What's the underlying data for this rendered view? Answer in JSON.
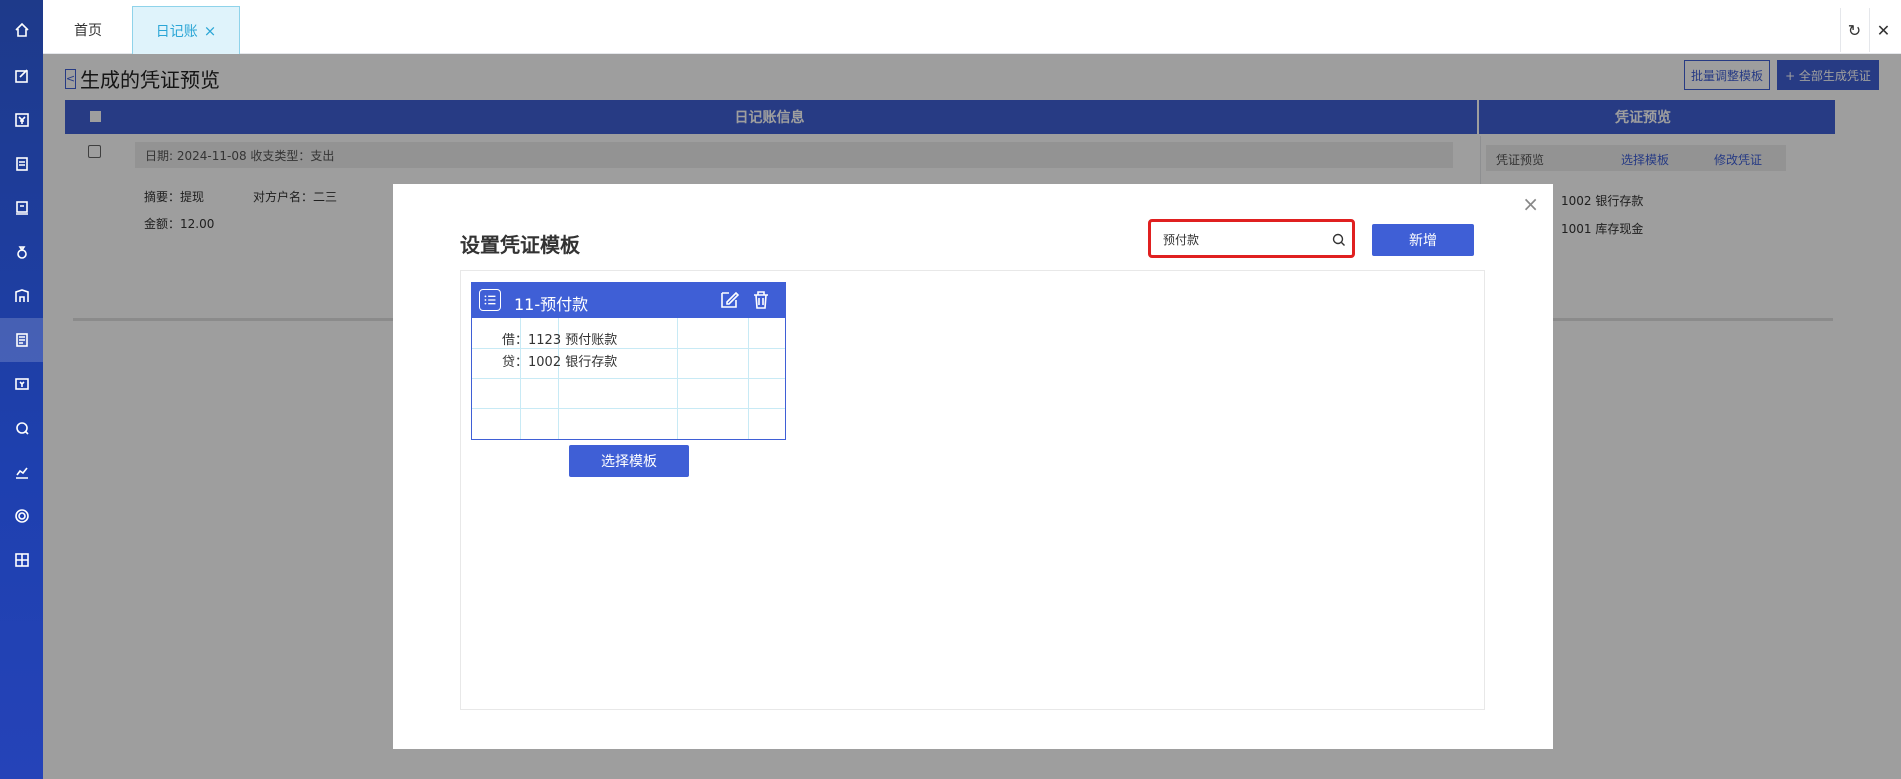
{
  "tabs": {
    "home": "首页",
    "active": "日记账",
    "close": "×"
  },
  "top_actions": {
    "refresh": "↻",
    "close": "✕"
  },
  "page": {
    "title": "生成的凭证预览",
    "back": "<",
    "batch_button": "批量调整模板",
    "generate_all_button": "+ 全部生成凭证",
    "header_left": "日记账信息",
    "header_right": "凭证预览"
  },
  "entry": {
    "info": "日期: 2024-11-08     收支类型：支出",
    "summary": "摘要：提现",
    "counterparty": "对方户名：二三",
    "amount": "金额：12.00"
  },
  "preview": {
    "label": "凭证预览",
    "select_template": "选择模板",
    "modify_voucher": "修改凭证",
    "lines": [
      "1002 银行存款",
      "1001 库存现金"
    ]
  },
  "modal": {
    "title": "设置凭证模板",
    "close": "×",
    "search_value": "预付款",
    "new_button": "新增",
    "card": {
      "title": "11-预付款",
      "debit": "借：1123 预付账款",
      "credit": "贷：1002 银行存款"
    },
    "select_button": "选择模板"
  }
}
